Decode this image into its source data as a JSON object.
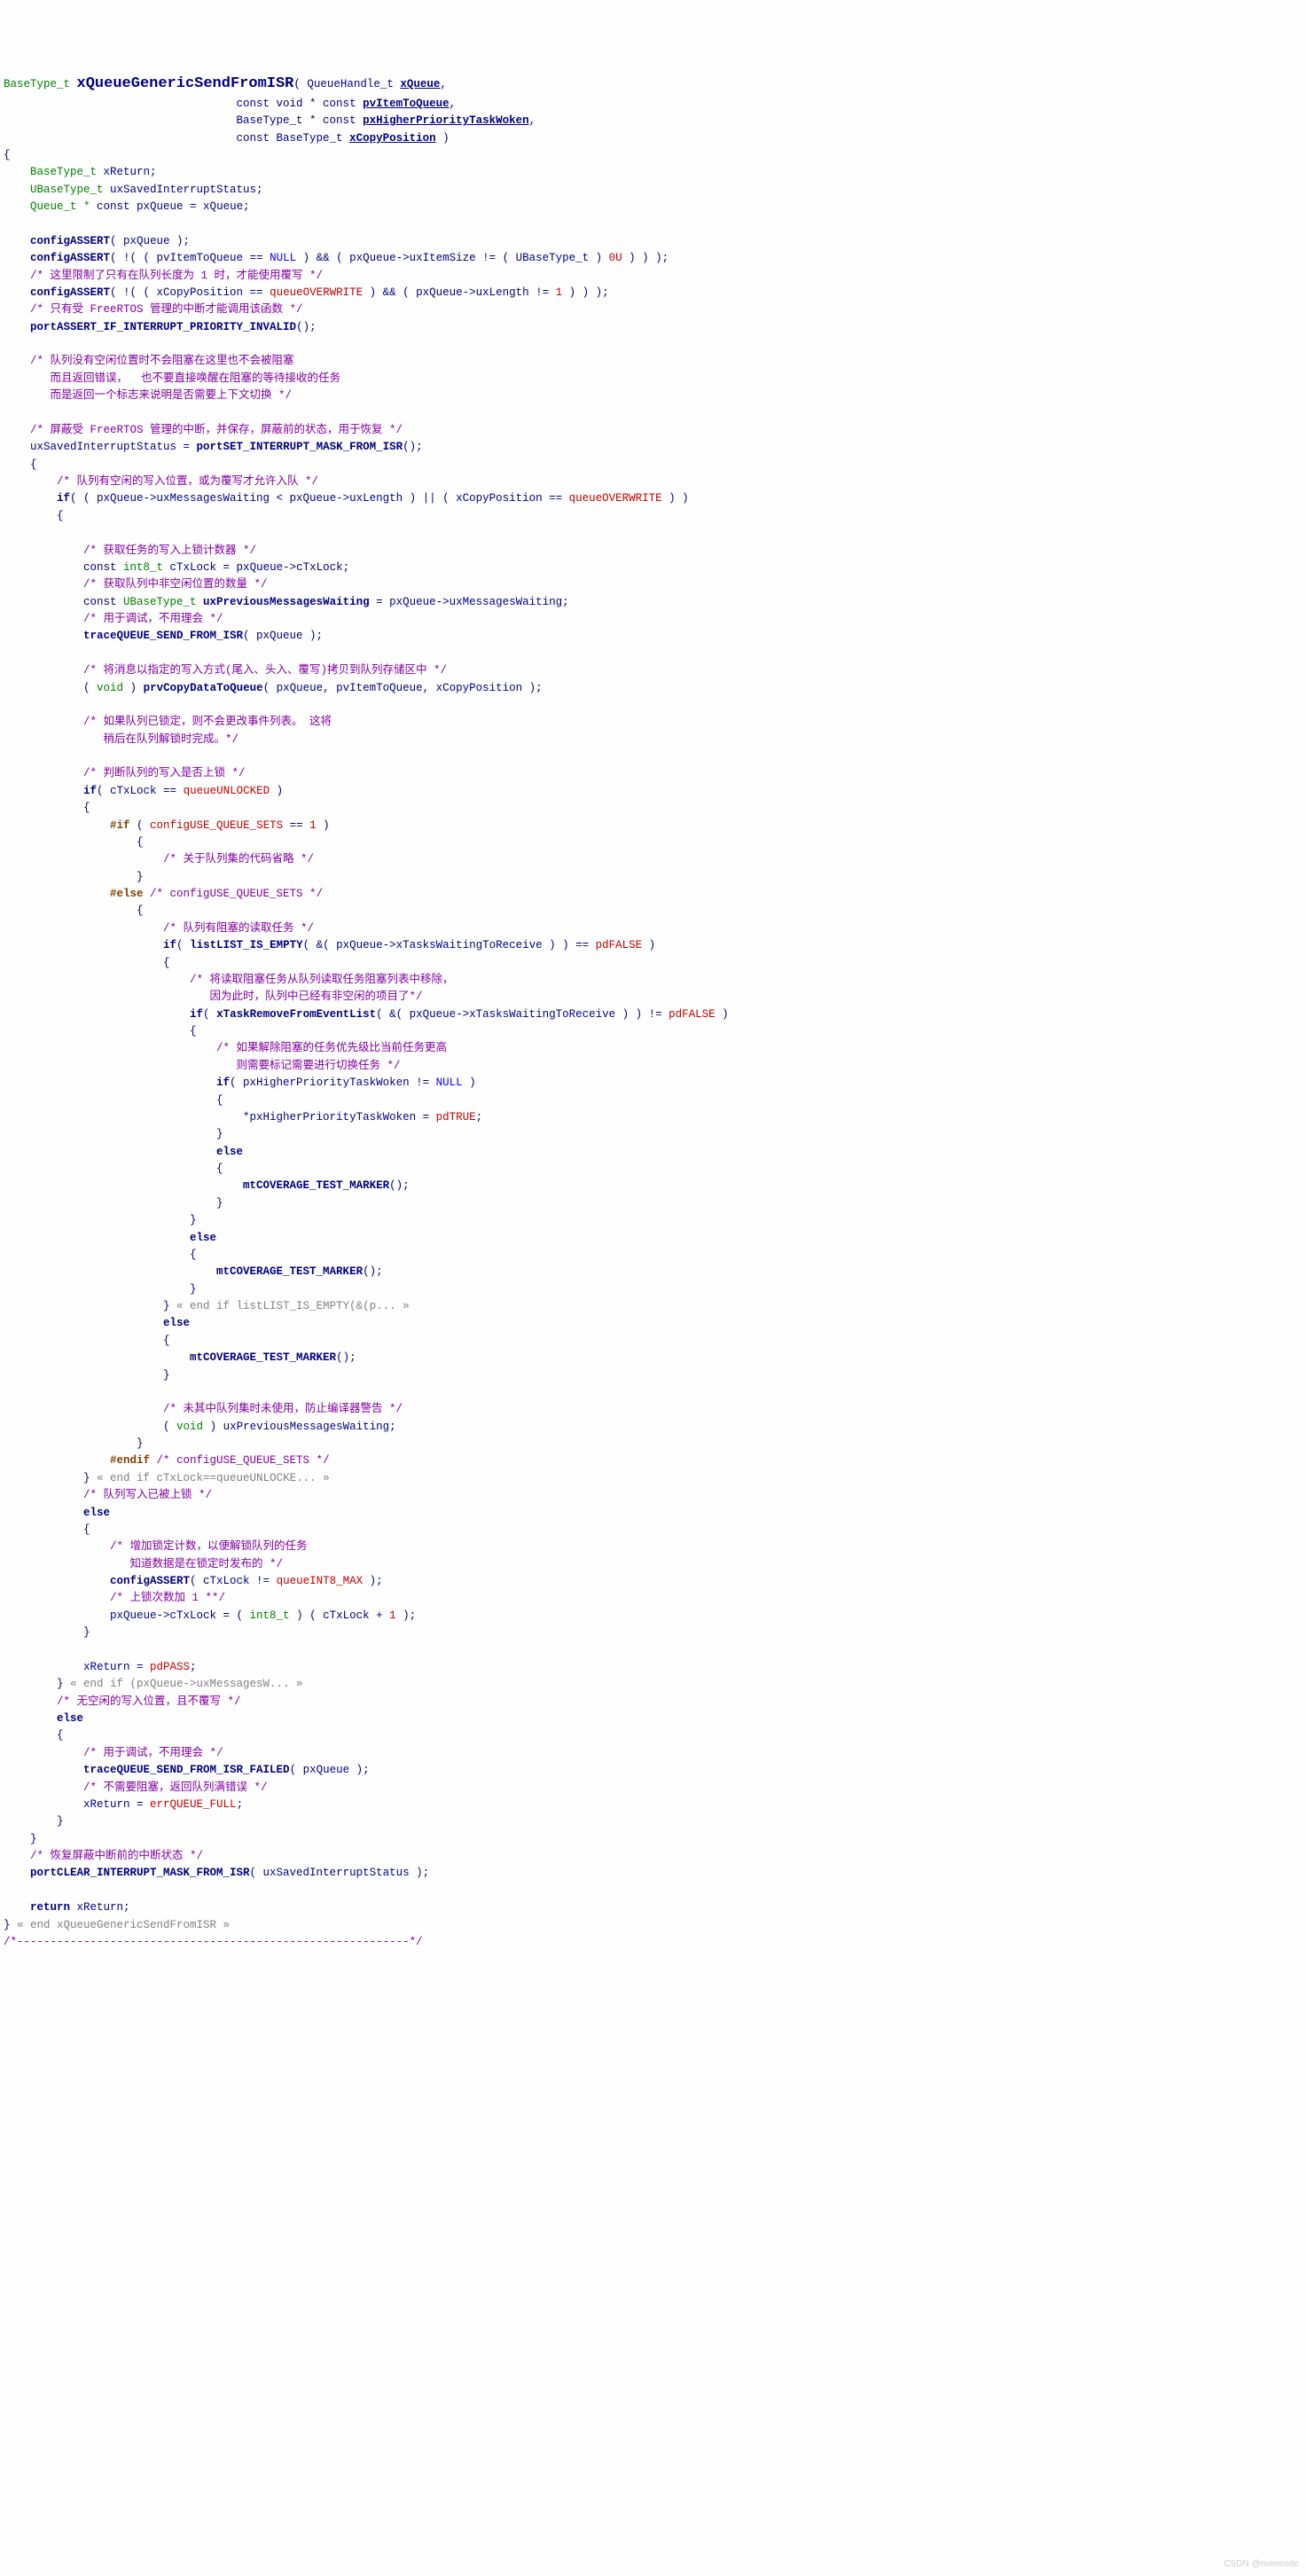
{
  "l1a": "BaseType_t",
  "l1b": "xQueueGenericSendFromISR",
  "l1c": "( QueueHandle_t ",
  "l1d": "xQueue",
  "l1e": ",",
  "l2a": "                                   const void * const ",
  "l2b": "pvItemToQueue",
  "l2c": ",",
  "l3a": "                                   BaseType_t * const ",
  "l3b": "pxHigherPriorityTaskWoken",
  "l3c": ",",
  "l4a": "                                   const BaseType_t ",
  "l4b": "xCopyPosition",
  "l4c": " )",
  "l5": "{",
  "l6a": "    BaseType_t ",
  "l6b": "xReturn;",
  "l7a": "    UBaseType_t ",
  "l7b": "uxSavedInterruptStatus;",
  "l8a": "    Queue_t * ",
  "l8b": "const",
  "l8c": " pxQueue = xQueue;",
  "l9": " ",
  "l10a": "    configASSERT",
  "l10b": "( pxQueue );",
  "l11a": "    configASSERT",
  "l11b": "( !( ( pvItemToQueue == ",
  "l11c": "NULL",
  "l11d": " ) && ( pxQueue->uxItemSize != ( UBaseType_t ) ",
  "l11e": "0U",
  "l11f": " ) ) );",
  "l12": "    /* 这里限制了只有在队列长度为 1 时，才能使用覆写 */",
  "l13a": "    configASSERT",
  "l13b": "( !( ( xCopyPosition == ",
  "l13c": "queueOVERWRITE",
  "l13d": " ) && ( pxQueue->uxLength != ",
  "l13e": "1",
  "l13f": " ) ) );",
  "l14": "    /* 只有受 FreeRTOS 管理的中断才能调用该函数 */",
  "l15a": "    portASSERT_IF_INTERRUPT_PRIORITY_INVALID",
  "l15b": "();",
  "l16": " ",
  "l17": "    /* 队列没有空闲位置时不会阻塞在这里也不会被阻塞",
  "l18": "       而且返回错误，  也不要直接唤醒在阻塞的等待接收的任务",
  "l19": "       而是返回一个标志来说明是否需要上下文切换 */",
  "l20": " ",
  "l21": "    /* 屏蔽受 FreeRTOS 管理的中断，并保存，屏蔽前的状态，用于恢复 */",
  "l22a": "    uxSavedInterruptStatus = ",
  "l22b": "portSET_INTERRUPT_MASK_FROM_ISR",
  "l22c": "();",
  "l23": "    {",
  "l24": "        /* 队列有空闲的写入位置，或为覆写才允许入队 */",
  "l25a": "        if",
  "l25b": "( ( pxQueue->uxMessagesWaiting < pxQueue->uxLength ) || ( xCopyPosition == ",
  "l25c": "queueOVERWRITE",
  "l25d": " ) )",
  "l26": "        {",
  "l27": " ",
  "l28": "            /* 获取任务的写入上锁计数器 */",
  "l29a": "            const ",
  "l29b": "int8_t",
  "l29c": " cTxLock = pxQueue->cTxLock;",
  "l30": "            /* 获取队列中非空闲位置的数量 */",
  "l31a": "            const ",
  "l31b": "UBaseType_t",
  "l31c": " uxPreviousMessagesWaiting",
  "l31d": " = pxQueue->uxMessagesWaiting;",
  "l32": "            /* 用于调试，不用理会 */",
  "l33a": "            traceQUEUE_SEND_FROM_ISR",
  "l33b": "( pxQueue );",
  "l34": " ",
  "l35": "            /* 将消息以指定的写入方式(尾入、头入、覆写)拷贝到队列存储区中 */",
  "l36a": "            ( ",
  "l36b": "void",
  "l36c": " ) ",
  "l36d": "prvCopyDataToQueue",
  "l36e": "( pxQueue, pvItemToQueue, xCopyPosition );",
  "l37": " ",
  "l38": "            /* 如果队列已锁定，则不会更改事件列表。 这将",
  "l39": "               稍后在队列解锁时完成。*/",
  "l40": " ",
  "l41": "            /* 判断队列的写入是否上锁 */",
  "l42a": "            if",
  "l42b": "( cTxLock == ",
  "l42c": "queueUNLOCKED",
  "l42d": " )",
  "l43": "            {",
  "l44a": "                #if",
  "l44b": " ( ",
  "l44c": "configUSE_QUEUE_SETS",
  "l44d": " == ",
  "l44e": "1",
  "l44f": " )",
  "l45": "                    {",
  "l46": "                        /* 关于队列集的代码省略 */",
  "l47": "                    }",
  "l48a": "                #else",
  "l48b": " /* configUSE_QUEUE_SETS */",
  "l49": "                    {",
  "l50": "                        /* 队列有阻塞的读取任务 */",
  "l51a": "                        if",
  "l51b": "( ",
  "l51c": "listLIST_IS_EMPTY",
  "l51d": "( &( pxQueue->xTasksWaitingToReceive ) ) == ",
  "l51e": "pdFALSE",
  "l51f": " )",
  "l52": "                        {",
  "l53": "                            /* 将读取阻塞任务从队列读取任务阻塞列表中移除，",
  "l54": "                               因为此时，队列中已经有非空闲的项目了*/",
  "l55a": "                            if",
  "l55b": "( ",
  "l55c": "xTaskRemoveFromEventList",
  "l55d": "( &( pxQueue->xTasksWaitingToReceive ) ) != ",
  "l55e": "pdFALSE",
  "l55f": " )",
  "l56": "                            {",
  "l57": "                                /* 如果解除阻塞的任务优先级比当前任务更高",
  "l58": "                                   则需要标记需要进行切换任务 */",
  "l59a": "                                if",
  "l59b": "( pxHigherPriorityTaskWoken != ",
  "l59c": "NULL",
  "l59d": " )",
  "l60": "                                {",
  "l61a": "                                    *pxHigherPriorityTaskWoken = ",
  "l61b": "pdTRUE",
  "l61c": ";",
  "l62": "                                }",
  "l63": "                                else",
  "l64": "                                {",
  "l65a": "                                    mtCOVERAGE_TEST_MARKER",
  "l65b": "();",
  "l66": "                                }",
  "l67": "                            }",
  "l68": "                            else",
  "l69": "                            {",
  "l70a": "                                mtCOVERAGE_TEST_MARKER",
  "l70b": "();",
  "l71": "                            }",
  "l72a": "                        }",
  "l72b": " « end if listLIST_IS_EMPTY(&(p... »",
  "l73": "                        else",
  "l74": "                        {",
  "l75a": "                            mtCOVERAGE_TEST_MARKER",
  "l75b": "();",
  "l76": "                        }",
  "l77": " ",
  "l78": "                        /* 未其中队列集时未使用，防止编译器警告 */",
  "l79a": "                        ( ",
  "l79b": "void",
  "l79c": " ) uxPreviousMessagesWaiting;",
  "l80": "                    }",
  "l81a": "                #endif",
  "l81b": " /* configUSE_QUEUE_SETS */",
  "l82a": "            }",
  "l82b": " « end if cTxLock==queueUNLOCKE... »",
  "l83": "            /* 队列写入已被上锁 */",
  "l84": "            else",
  "l85": "            {",
  "l86": "                /* 增加锁定计数，以便解锁队列的任务",
  "l87": "                   知道数据是在锁定时发布的 */",
  "l88a": "                configASSERT",
  "l88b": "( cTxLock != ",
  "l88c": "queueINT8_MAX",
  "l88d": " );",
  "l89": "                /* 上锁次数加 1 **/",
  "l90a": "                pxQueue->cTxLock = ( ",
  "l90b": "int8_t",
  "l90c": " ) ( cTxLock + ",
  "l90d": "1",
  "l90e": " );",
  "l91": "            }",
  "l92": " ",
  "l93a": "            xReturn = ",
  "l93b": "pdPASS",
  "l93c": ";",
  "l94a": "        }",
  "l94b": " « end if (pxQueue->uxMessagesW... »",
  "l95": "        /* 无空闲的写入位置，且不覆写 */",
  "l96": "        else",
  "l97": "        {",
  "l98": "            /* 用于调试，不用理会 */",
  "l99a": "            traceQUEUE_SEND_FROM_ISR_FAILED",
  "l99b": "( pxQueue );",
  "l100": "            /* 不需要阻塞，返回队列满错误 */",
  "l101a": "            xReturn = ",
  "l101b": "errQUEUE_FULL",
  "l101c": ";",
  "l102": "        }",
  "l103": "    }",
  "l104": "    /* 恢复屏蔽中断前的中断状态 */",
  "l105a": "    portCLEAR_INTERRUPT_MASK_FROM_ISR",
  "l105b": "( uxSavedInterruptStatus );",
  "l106": " ",
  "l107a": "    return",
  "l107b": " xReturn;",
  "l108a": "}",
  "l108b": " « end xQueueGenericSendFromISR »",
  "l109": "/*-----------------------------------------------------------*/",
  "wm": "CSDN @nvencode"
}
